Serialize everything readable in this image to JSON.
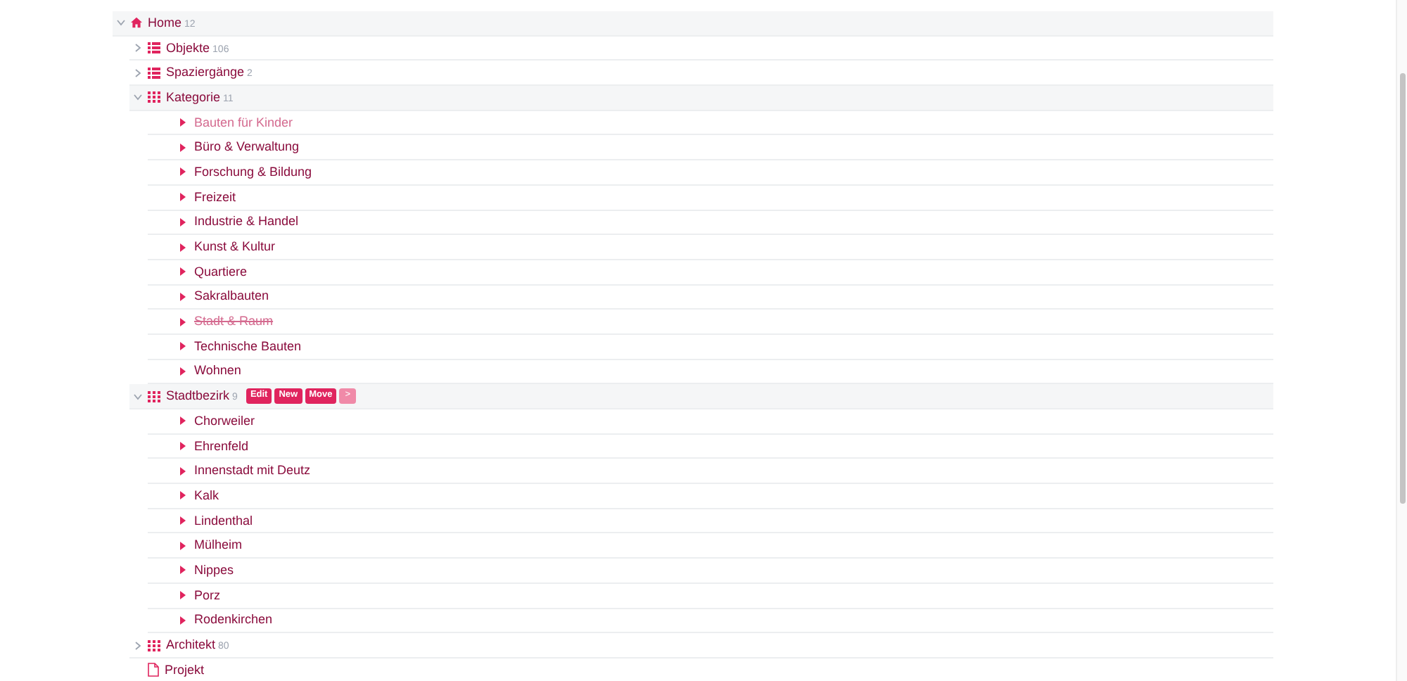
{
  "tree": [
    {
      "label": "Home",
      "count": "12",
      "kind": "home",
      "expanded": true,
      "children": [
        {
          "label": "Objekte",
          "count": "106",
          "kind": "list",
          "expanded": false
        },
        {
          "label": "Spaziergänge",
          "count": "2",
          "kind": "list",
          "expanded": false
        },
        {
          "label": "Kategorie",
          "count": "11",
          "kind": "grid",
          "expanded": true,
          "children": [
            {
              "label": "Bauten für Kinder",
              "kind": "leaf",
              "disabled": true,
              "deleted": false
            },
            {
              "label": "Büro & Verwaltung",
              "kind": "leaf",
              "disabled": false,
              "deleted": false
            },
            {
              "label": "Forschung & Bildung",
              "kind": "leaf",
              "disabled": false,
              "deleted": false
            },
            {
              "label": "Freizeit",
              "kind": "leaf",
              "disabled": false,
              "deleted": false
            },
            {
              "label": "Industrie & Handel",
              "kind": "leaf",
              "disabled": false,
              "deleted": false
            },
            {
              "label": "Kunst & Kultur",
              "kind": "leaf",
              "disabled": false,
              "deleted": false
            },
            {
              "label": "Quartiere",
              "kind": "leaf",
              "disabled": false,
              "deleted": false
            },
            {
              "label": "Sakralbauten",
              "kind": "leaf",
              "disabled": false,
              "deleted": false
            },
            {
              "label": "Stadt & Raum",
              "kind": "leaf",
              "disabled": true,
              "deleted": true
            },
            {
              "label": "Technische Bauten",
              "kind": "leaf",
              "disabled": false,
              "deleted": false
            },
            {
              "label": "Wohnen",
              "kind": "leaf",
              "disabled": false,
              "deleted": false
            }
          ]
        },
        {
          "label": "Stadtbezirk",
          "count": "9",
          "kind": "grid",
          "expanded": true,
          "actions": [
            {
              "label": "Edit",
              "disabled": false
            },
            {
              "label": "New",
              "disabled": false
            },
            {
              "label": "Move",
              "disabled": false
            },
            {
              "label": ">",
              "disabled": true
            }
          ],
          "children": [
            {
              "label": "Chorweiler",
              "kind": "leaf"
            },
            {
              "label": "Ehrenfeld",
              "kind": "leaf"
            },
            {
              "label": "Innenstadt mit Deutz",
              "kind": "leaf"
            },
            {
              "label": "Kalk",
              "kind": "leaf"
            },
            {
              "label": "Lindenthal",
              "kind": "leaf"
            },
            {
              "label": "Mülheim",
              "kind": "leaf"
            },
            {
              "label": "Nippes",
              "kind": "leaf"
            },
            {
              "label": "Porz",
              "kind": "leaf"
            },
            {
              "label": "Rodenkirchen",
              "kind": "leaf"
            }
          ]
        },
        {
          "label": "Architekt",
          "count": "80",
          "kind": "grid",
          "expanded": false
        },
        {
          "label": "Projekt",
          "kind": "page"
        }
      ]
    }
  ]
}
